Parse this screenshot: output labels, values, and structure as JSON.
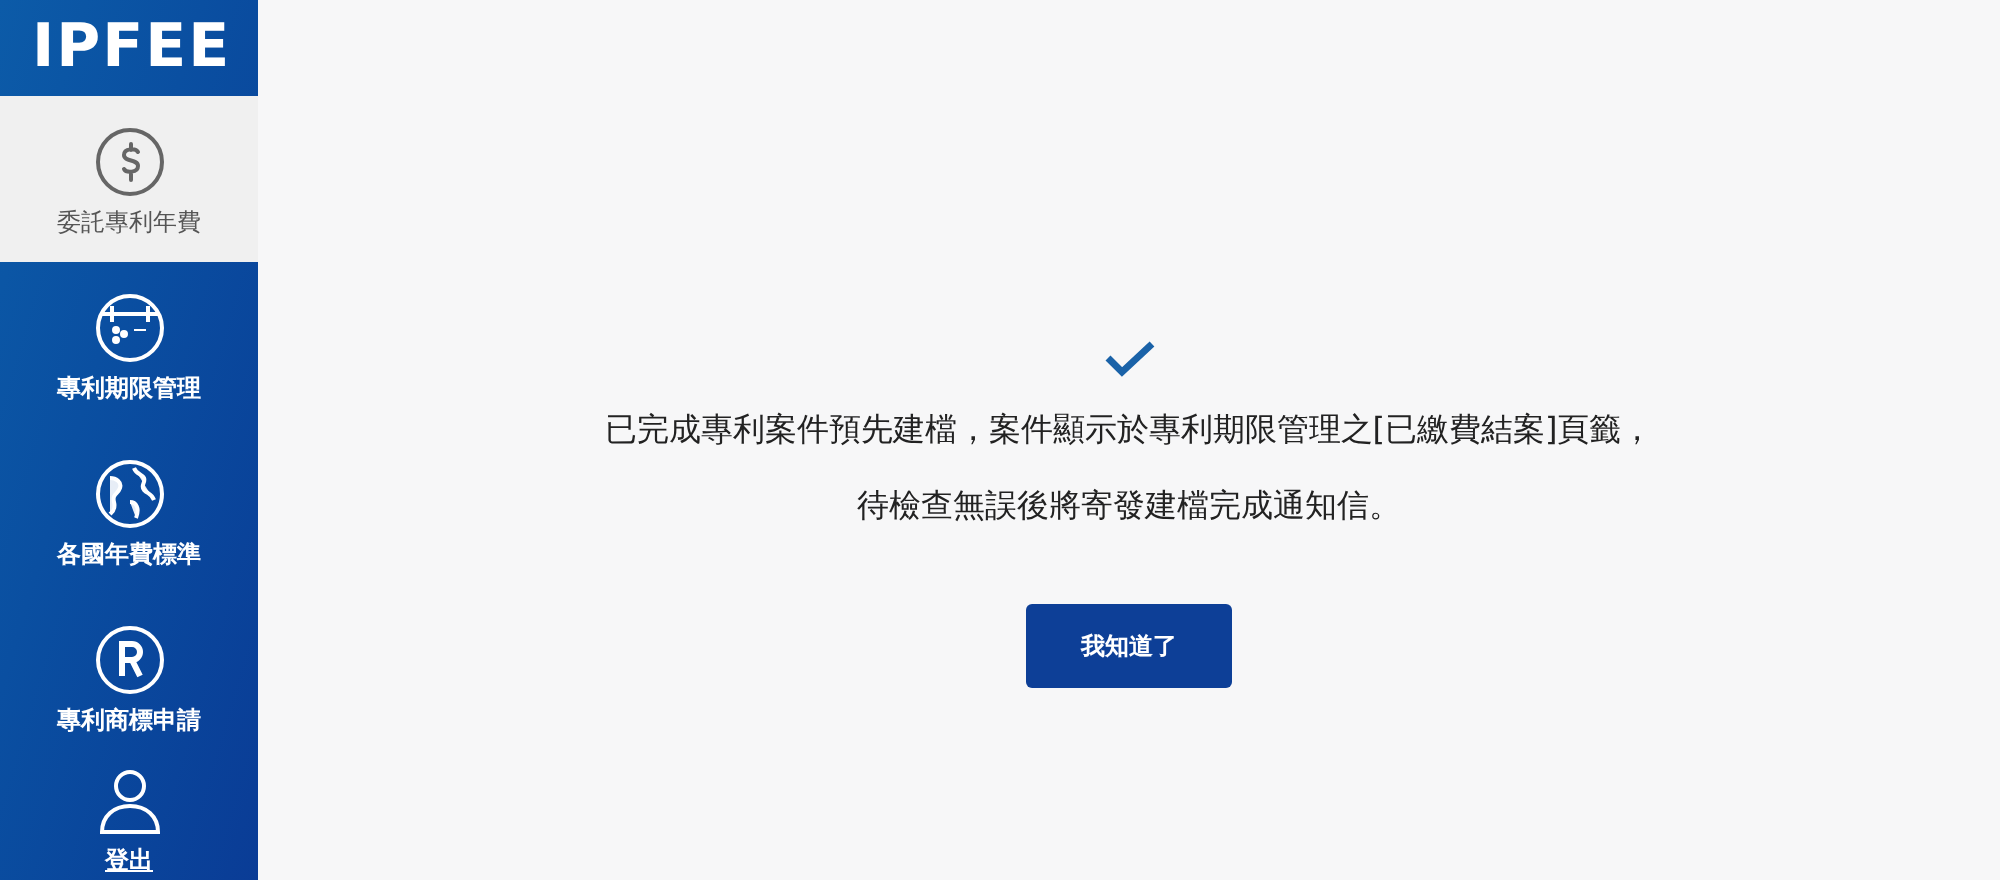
{
  "logo": "IPFEE",
  "nav": [
    {
      "kind": "fee",
      "label": "委託專利年費",
      "selected": true
    },
    {
      "kind": "calendar",
      "label": "專利期限管理",
      "selected": false
    },
    {
      "kind": "globe",
      "label": "各國年費標準",
      "selected": false
    },
    {
      "kind": "registered",
      "label": "專利商標申請",
      "selected": false
    },
    {
      "kind": "logout",
      "label": "登出",
      "selected": false
    }
  ],
  "message": {
    "lines": [
      "已完成專利案件預先建檔，案件顯示於專利期限管理之[已繳費結案]頁籤，",
      "待檢查無誤後將寄發建檔完成通知信。"
    ],
    "button": "我知道了"
  }
}
